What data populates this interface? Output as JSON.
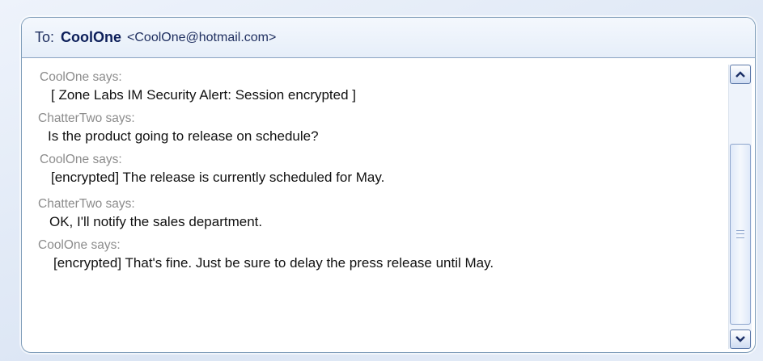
{
  "header": {
    "to_label": "To:",
    "contact_name": "CoolOne",
    "contact_email": "<CoolOne@hotmail.com>"
  },
  "messages": [
    {
      "sender": "CoolOne says:",
      "text": "[ Zone Labs IM Security Alert: Session encrypted ]"
    },
    {
      "sender": "ChatterTwo says:",
      "text": "Is the product going to release on schedule?"
    },
    {
      "sender": "CoolOne says:",
      "text": "[encrypted] The release is currently scheduled for May."
    },
    {
      "sender": "ChatterTwo says:",
      "text": "OK, I'll notify the sales department."
    },
    {
      "sender": "CoolOne says:",
      "text": "[encrypted] That's fine. Just be sure to delay the press release until May."
    }
  ],
  "scrollbar": {
    "up_icon": "chevron-up-icon",
    "down_icon": "chevron-down-icon",
    "grip_icon": "grip-icon"
  }
}
